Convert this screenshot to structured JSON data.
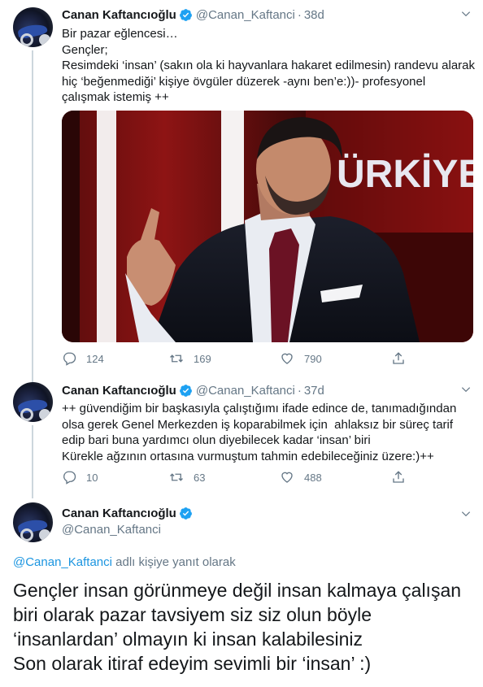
{
  "tweets": [
    {
      "name": "Canan Kaftancıoğlu",
      "handle": "@Canan_Kaftanci",
      "separator": "·",
      "time": "38d",
      "text": "Bir pazar eğlencesi…\nGençler;\nResimdeki ‘insan’ (sakın ola ki hayvanlara hakaret edilmesin) randevu alarak hiç ‘beğenmediği’ kişiye övgüler düzerek -aynı ben’e:))- profesyonel çalışmak istemiş ++",
      "media": {
        "description_icon": "tv-interview-photo",
        "overlay_text": "ÜRKİYE"
      },
      "replies": "124",
      "retweets": "169",
      "likes": "790"
    },
    {
      "name": "Canan Kaftancıoğlu",
      "handle": "@Canan_Kaftanci",
      "separator": "·",
      "time": "37d",
      "text": "++ güvendiğim bir başkasıyla çalıştığımı ifade edince de, tanımadığından olsa gerek Genel Merkezden iş koparabilmek için  ahlaksız bir süreç tarif edip bari buna yardımcı olun diyebilecek kadar ‘insan’ biri\nKürekle ağzının ortasına vurmuştum tahmin edebileceğiniz üzere:)++",
      "replies": "10",
      "retweets": "63",
      "likes": "488"
    }
  ],
  "main_tweet": {
    "name": "Canan Kaftancıoğlu",
    "handle": "@Canan_Kaftanci",
    "reply_handle": "@Canan_Kaftanci",
    "reply_suffix": " adlı kişiye yanıt olarak",
    "text": "Gençler insan görünmeye değil insan kalmaya çalışan biri olarak pazar tavsiyem siz siz olun böyle ‘insanlardan’ olmayın ki insan kalabilesiniz\nSon olarak itiraf edeyim sevimli bir ‘insan’ :)"
  },
  "colors": {
    "verified": "#1da1f2",
    "link": "#1b95e0",
    "muted": "#657786"
  },
  "icons": [
    "reply-icon",
    "retweet-icon",
    "like-icon",
    "share-icon",
    "chevron-down-icon",
    "verified-badge-icon"
  ]
}
